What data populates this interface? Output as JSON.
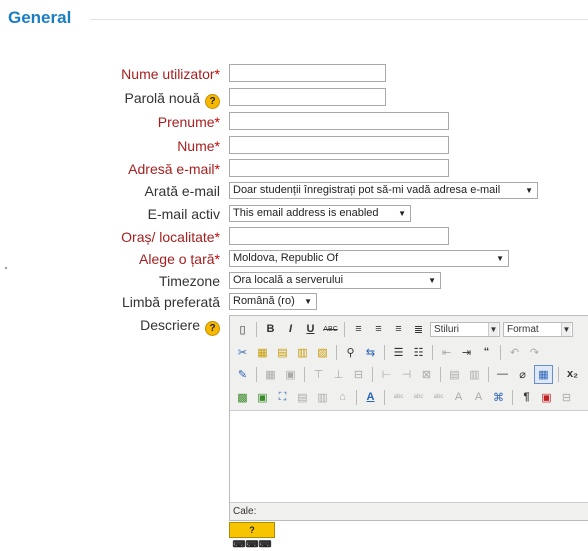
{
  "section": {
    "title": "General"
  },
  "form": {
    "username": {
      "label": "Nume utilizator",
      "value": ""
    },
    "new_password": {
      "label": "Parolă nouă",
      "value": ""
    },
    "firstname": {
      "label": "Prenume",
      "value": ""
    },
    "lastname": {
      "label": "Nume",
      "value": ""
    },
    "email": {
      "label": "Adresă e-mail",
      "value": ""
    },
    "email_display": {
      "label": "Arată e-mail",
      "value": "Doar studenții înregistrați pot să-mi vadă adresa e-mail"
    },
    "email_active": {
      "label": "E-mail activ",
      "value": "This email address is enabled"
    },
    "city": {
      "label": "Oraș/ localitate",
      "value": ""
    },
    "country": {
      "label": "Alege o țară",
      "value": "Moldova, Republic Of"
    },
    "timezone": {
      "label": "Timezone",
      "value": "Ora locală a serverului"
    },
    "language": {
      "label": "Limbă preferată",
      "value": "Română (ro)"
    },
    "description": {
      "label": "Descriere"
    },
    "required_mark": "*",
    "help_glyph": "?"
  },
  "editor": {
    "styles_label": "Stiluri",
    "format_label": "Format",
    "path_label": "Cale:",
    "keyboard_help": "? ⌨⌨⌨",
    "buttons": {
      "bold": "B",
      "italic": "I",
      "underline": "U",
      "strike": "ABC",
      "quote": "“"
    }
  },
  "icons": {
    "help": "help-icon",
    "dropdown": "chevron-down-icon",
    "new_doc": "new-document-icon"
  }
}
